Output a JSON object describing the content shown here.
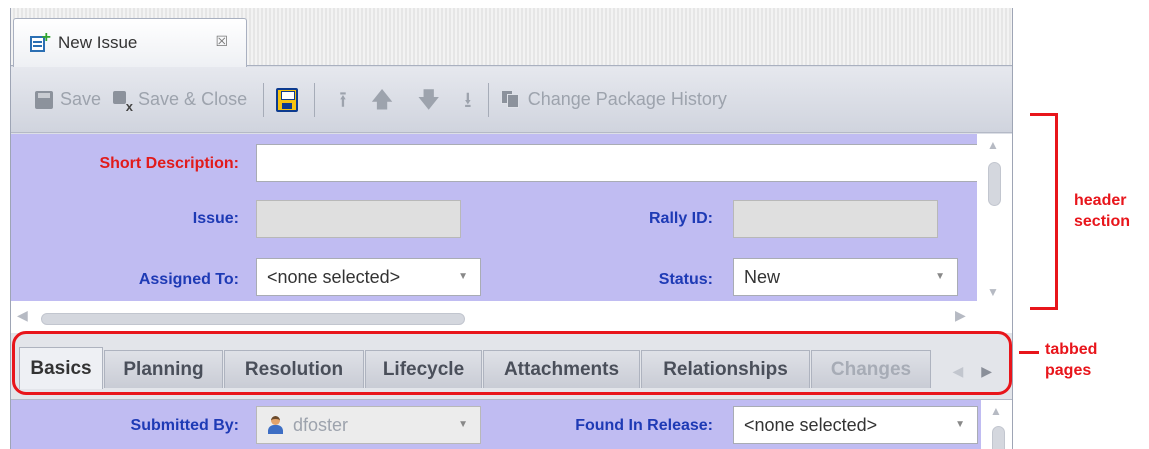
{
  "document_tab": {
    "title": "New Issue",
    "icon": "new-issue-icon",
    "close_icon": "close-icon",
    "close_glyph": "☒"
  },
  "toolbar": {
    "save_label": "Save",
    "save_close_label": "Save & Close",
    "change_package_history_label": "Change Package History",
    "arrow_top": "⭱",
    "arrow_up": "🡅",
    "arrow_down": "🡇",
    "arrow_bottom": "⭳"
  },
  "header": {
    "short_description_label": "Short Description:",
    "short_description_value": "",
    "issue_label": "Issue:",
    "issue_value": "",
    "rally_id_label": "Rally ID:",
    "rally_id_value": "",
    "assigned_to_label": "Assigned To:",
    "assigned_to_value": "<none selected>",
    "status_label": "Status:",
    "status_value": "New",
    "background_color": "#c0bcf2",
    "required_color": "#e11b1b",
    "label_color": "#1e3ab5"
  },
  "page_tabs": {
    "items": [
      {
        "label": "Basics"
      },
      {
        "label": "Planning"
      },
      {
        "label": "Resolution"
      },
      {
        "label": "Lifecycle"
      },
      {
        "label": "Attachments"
      },
      {
        "label": "Relationships"
      },
      {
        "label": "Changes"
      }
    ],
    "active": "Basics",
    "prev_glyph": "◀",
    "next_glyph": "▶"
  },
  "basics": {
    "submitted_by_label": "Submitted By:",
    "submitted_by_value": "dfoster",
    "found_in_release_label": "Found In Release:",
    "found_in_release_value": "<none selected>"
  },
  "annotations": {
    "header_section_line1": "header",
    "header_section_line2": "section",
    "tabbed_pages_line1": "tabbed",
    "tabbed_pages_line2": "pages",
    "color": "#e8151b"
  }
}
